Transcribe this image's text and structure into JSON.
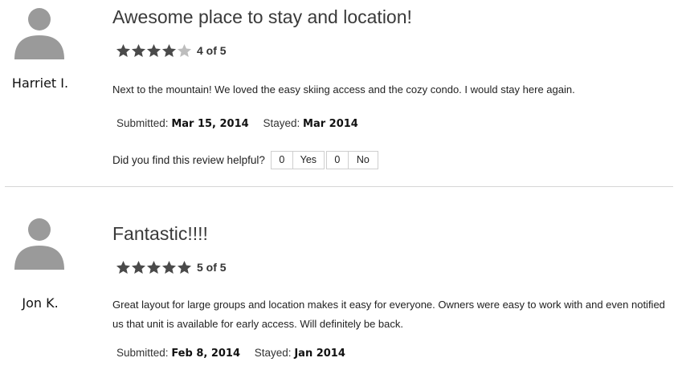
{
  "colors": {
    "star_filled": "#4a4a4a",
    "star_empty": "#bdbdbd",
    "avatar": "#9a9a9a",
    "divider": "#d6d6d6"
  },
  "reviews": [
    {
      "reviewer": "Harriet I.",
      "title": "Awesome place to stay and location!",
      "rating": 4,
      "rating_text": "4 of 5",
      "body": "Next to the mountain! We loved the easy skiing access and the cozy condo. I would stay here again.",
      "submitted_label": "Submitted:",
      "submitted": "Mar 15, 2014",
      "stayed_label": "Stayed:",
      "stayed": "Mar 2014",
      "helpful": {
        "question": "Did you find this review helpful?",
        "yes_count": "0",
        "yes_label": "Yes",
        "no_count": "0",
        "no_label": "No"
      }
    },
    {
      "reviewer": "Jon K.",
      "title": "Fantastic!!!!",
      "rating": 5,
      "rating_text": "5 of 5",
      "body": "Great layout for large groups and location makes it easy for everyone. Owners were easy to work with and even notified us that unit is available for early access. Will definitely be back.",
      "submitted_label": "Submitted:",
      "submitted": "Feb 8, 2014",
      "stayed_label": "Stayed:",
      "stayed": "Jan 2014"
    }
  ]
}
